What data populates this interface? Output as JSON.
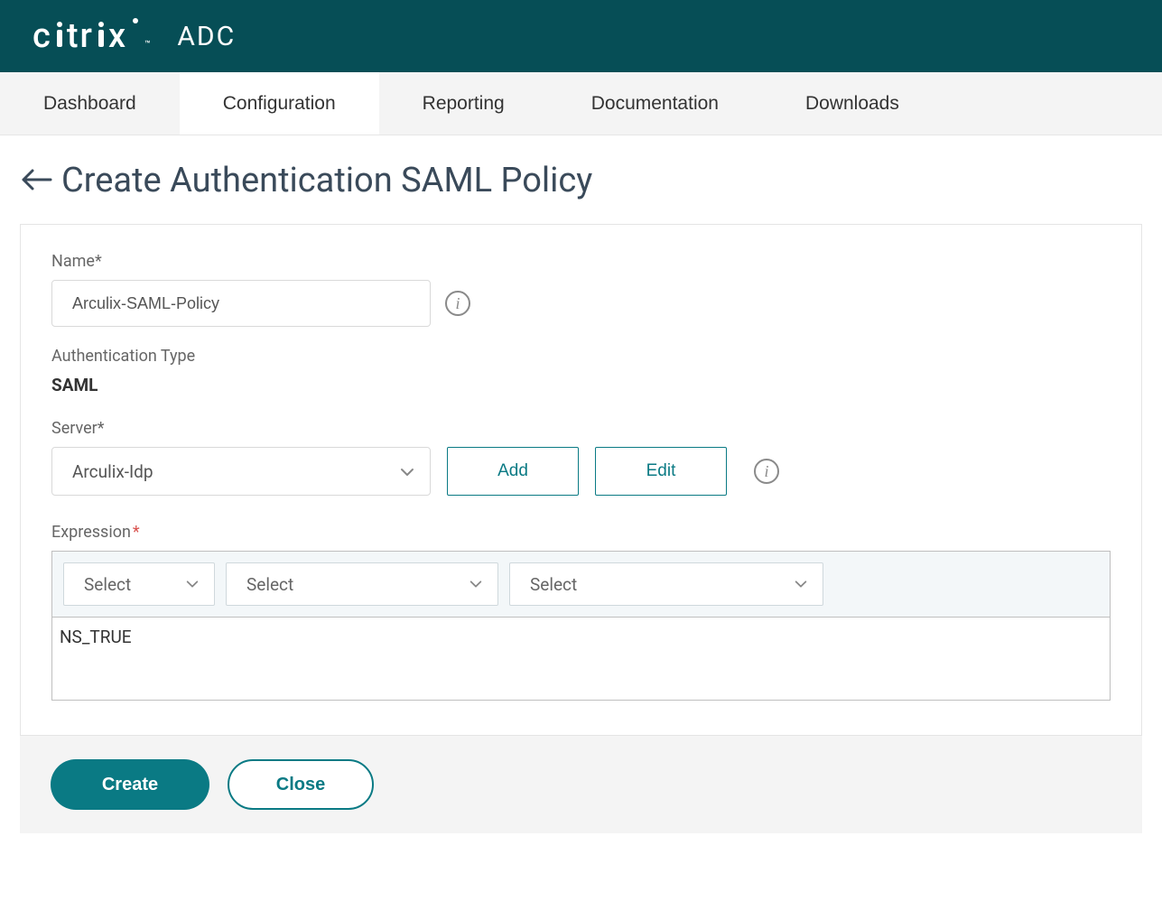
{
  "brand": {
    "logo_text_a": "c",
    "logo_text_b": "tr",
    "logo_text_c": "x",
    "product": "ADC"
  },
  "nav": {
    "tabs": [
      "Dashboard",
      "Configuration",
      "Reporting",
      "Documentation",
      "Downloads"
    ],
    "active_index": 1
  },
  "page": {
    "title": "Create Authentication SAML Policy"
  },
  "form": {
    "name_label": "Name*",
    "name_value": "Arculix-SAML-Policy",
    "auth_type_label": "Authentication Type",
    "auth_type_value": "SAML",
    "server_label": "Server*",
    "server_value": "Arculix-Idp",
    "add_label": "Add",
    "edit_label": "Edit",
    "expression_label": "Expression",
    "expression_star": "*",
    "expr_selects": [
      "Select",
      "Select",
      "Select"
    ],
    "expression_value": "NS_TRUE"
  },
  "actions": {
    "create": "Create",
    "close": "Close"
  }
}
